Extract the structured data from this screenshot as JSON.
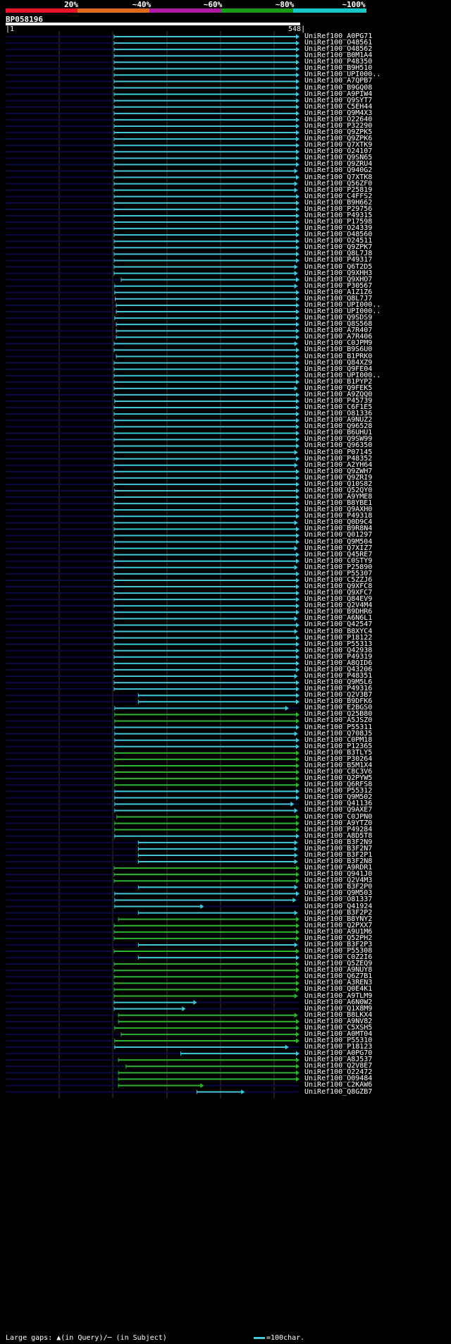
{
  "legend": {
    "ticks": [
      "20%",
      "~40%",
      "~60%",
      "~80%",
      "~100%"
    ],
    "colors": [
      "#e8142a",
      "#e06a1a",
      "#b01aa0",
      "#1a9a1a",
      "#18c8c8"
    ]
  },
  "query": {
    "name": "BP058196",
    "start": "1",
    "end": "548"
  },
  "colors": {
    "hit_cyan": "#41c6d6",
    "hit_green": "#2db52d",
    "track": "#0a0a44",
    "grid": "#3a3a3a"
  },
  "hits": [
    {
      "label": "UniRef100_A0PG71",
      "color": "cyan",
      "start": 203,
      "end": 548
    },
    {
      "label": "UniRef100_O48561",
      "color": "cyan",
      "start": 203,
      "end": 548
    },
    {
      "label": "UniRef100_O48562",
      "color": "cyan",
      "start": 203,
      "end": 548
    },
    {
      "label": "UniRef100_B0M1A4",
      "color": "cyan",
      "start": 203,
      "end": 548
    },
    {
      "label": "UniRef100_P48350",
      "color": "cyan",
      "start": 203,
      "end": 548
    },
    {
      "label": "UniRef100_B9H510",
      "color": "cyan",
      "start": 203,
      "end": 548
    },
    {
      "label": "UniRef100_UPI000..",
      "color": "cyan",
      "start": 203,
      "end": 548
    },
    {
      "label": "UniRef100_A7QPB7",
      "color": "cyan",
      "start": 203,
      "end": 548
    },
    {
      "label": "UniRef100_B9GQ08",
      "color": "cyan",
      "start": 203,
      "end": 548
    },
    {
      "label": "UniRef100_A9PIW4",
      "color": "cyan",
      "start": 203,
      "end": 548
    },
    {
      "label": "UniRef100_Q9SYT7",
      "color": "cyan",
      "start": 203,
      "end": 548
    },
    {
      "label": "UniRef100_C5EH44",
      "color": "cyan",
      "start": 203,
      "end": 548
    },
    {
      "label": "UniRef100_Q9M4X3",
      "color": "cyan",
      "start": 203,
      "end": 548
    },
    {
      "label": "UniRef100_O22640",
      "color": "cyan",
      "start": 203,
      "end": 548
    },
    {
      "label": "UniRef100_P32290",
      "color": "cyan",
      "start": 203,
      "end": 548
    },
    {
      "label": "UniRef100_Q9ZPK5",
      "color": "cyan",
      "start": 203,
      "end": 548
    },
    {
      "label": "UniRef100_Q9ZPK6",
      "color": "cyan",
      "start": 203,
      "end": 548
    },
    {
      "label": "UniRef100_Q7XTK9",
      "color": "cyan",
      "start": 203,
      "end": 548
    },
    {
      "label": "UniRef100_O24107",
      "color": "cyan",
      "start": 203,
      "end": 548
    },
    {
      "label": "UniRef100_Q9SN65",
      "color": "cyan",
      "start": 203,
      "end": 548
    },
    {
      "label": "UniRef100_Q9ZRU4",
      "color": "cyan",
      "start": 203,
      "end": 548
    },
    {
      "label": "UniRef100_Q940G2",
      "color": "cyan",
      "start": 203,
      "end": 545
    },
    {
      "label": "UniRef100_Q7XTK8",
      "color": "cyan",
      "start": 203,
      "end": 548
    },
    {
      "label": "UniRef100_Q56ZF0",
      "color": "cyan",
      "start": 203,
      "end": 545
    },
    {
      "label": "UniRef100_P25819",
      "color": "cyan",
      "start": 203,
      "end": 545
    },
    {
      "label": "UniRef100_C4FFS2",
      "color": "cyan",
      "start": 203,
      "end": 548
    },
    {
      "label": "UniRef100_B9H662",
      "color": "cyan",
      "start": 203,
      "end": 548
    },
    {
      "label": "UniRef100_P29756",
      "color": "cyan",
      "start": 203,
      "end": 548
    },
    {
      "label": "UniRef100_P49315",
      "color": "cyan",
      "start": 203,
      "end": 548
    },
    {
      "label": "UniRef100_P17598",
      "color": "cyan",
      "start": 203,
      "end": 548
    },
    {
      "label": "UniRef100_O24339",
      "color": "cyan",
      "start": 203,
      "end": 548
    },
    {
      "label": "UniRef100_O48560",
      "color": "cyan",
      "start": 203,
      "end": 548
    },
    {
      "label": "UniRef100_O24511",
      "color": "cyan",
      "start": 203,
      "end": 548
    },
    {
      "label": "UniRef100_Q9ZPK7",
      "color": "cyan",
      "start": 203,
      "end": 548
    },
    {
      "label": "UniRef100_Q8L7J8",
      "color": "cyan",
      "start": 203,
      "end": 548
    },
    {
      "label": "UniRef100_P49317",
      "color": "cyan",
      "start": 203,
      "end": 548
    },
    {
      "label": "UniRef100_Q6T2D5",
      "color": "cyan",
      "start": 203,
      "end": 545
    },
    {
      "label": "UniRef100_Q9XHH3",
      "color": "cyan",
      "start": 203,
      "end": 545
    },
    {
      "label": "UniRef100_Q9XHO7",
      "color": "cyan",
      "start": 216,
      "end": 548
    },
    {
      "label": "UniRef100_P30567",
      "color": "cyan",
      "start": 204,
      "end": 545
    },
    {
      "label": "UniRef100_A1Z1Z6",
      "color": "cyan",
      "start": 204,
      "end": 548
    },
    {
      "label": "UniRef100_Q8L7J7",
      "color": "cyan",
      "start": 205,
      "end": 548
    },
    {
      "label": "UniRef100_UPI000..",
      "color": "cyan",
      "start": 207,
      "end": 548
    },
    {
      "label": "UniRef100_UPI000..",
      "color": "cyan",
      "start": 207,
      "end": 548
    },
    {
      "label": "UniRef100_Q9SDS9",
      "color": "cyan",
      "start": 204,
      "end": 548
    },
    {
      "label": "UniRef100_Q8S568",
      "color": "cyan",
      "start": 207,
      "end": 548
    },
    {
      "label": "UniRef100_A7R407",
      "color": "cyan",
      "start": 207,
      "end": 548
    },
    {
      "label": "UniRef100_A7R406",
      "color": "cyan",
      "start": 207,
      "end": 548
    },
    {
      "label": "UniRef100_C0JPM9",
      "color": "cyan",
      "start": 203,
      "end": 545
    },
    {
      "label": "UniRef100_B9S6U0",
      "color": "cyan",
      "start": 203,
      "end": 548
    },
    {
      "label": "UniRef100_B1PRK0",
      "color": "cyan",
      "start": 207,
      "end": 548
    },
    {
      "label": "UniRef100_Q84XZ9",
      "color": "cyan",
      "start": 203,
      "end": 548
    },
    {
      "label": "UniRef100_Q9FE04",
      "color": "cyan",
      "start": 203,
      "end": 548
    },
    {
      "label": "UniRef100_UPI000..",
      "color": "cyan",
      "start": 203,
      "end": 548
    },
    {
      "label": "UniRef100_B1PYP2",
      "color": "cyan",
      "start": 203,
      "end": 548
    },
    {
      "label": "UniRef100_Q9FEK5",
      "color": "cyan",
      "start": 203,
      "end": 545
    },
    {
      "label": "UniRef100_A9ZQQ0",
      "color": "cyan",
      "start": 203,
      "end": 548
    },
    {
      "label": "UniRef100_P45739",
      "color": "cyan",
      "start": 204,
      "end": 548
    },
    {
      "label": "UniRef100_C6F1E5",
      "color": "cyan",
      "start": 203,
      "end": 548
    },
    {
      "label": "UniRef100_O81336",
      "color": "cyan",
      "start": 203,
      "end": 548
    },
    {
      "label": "UniRef100_A9NUZ2",
      "color": "cyan",
      "start": 203,
      "end": 548
    },
    {
      "label": "UniRef100_Q96528",
      "color": "cyan",
      "start": 204,
      "end": 548
    },
    {
      "label": "UniRef100_B6UHU1",
      "color": "cyan",
      "start": 203,
      "end": 548
    },
    {
      "label": "UniRef100_Q9SW99",
      "color": "cyan",
      "start": 203,
      "end": 548
    },
    {
      "label": "UniRef100_Q96350",
      "color": "cyan",
      "start": 203,
      "end": 548
    },
    {
      "label": "UniRef100_P07145",
      "color": "cyan",
      "start": 203,
      "end": 545
    },
    {
      "label": "UniRef100_P48352",
      "color": "cyan",
      "start": 203,
      "end": 548
    },
    {
      "label": "UniRef100_A2YH64",
      "color": "cyan",
      "start": 203,
      "end": 545
    },
    {
      "label": "UniRef100_Q9ZWH7",
      "color": "cyan",
      "start": 203,
      "end": 548
    },
    {
      "label": "UniRef100_Q9ZRI9",
      "color": "cyan",
      "start": 203,
      "end": 548
    },
    {
      "label": "UniRef100_Q10S82",
      "color": "cyan",
      "start": 203,
      "end": 548
    },
    {
      "label": "UniRef100_Q52QY0",
      "color": "cyan",
      "start": 204,
      "end": 548
    },
    {
      "label": "UniRef100_A9YME8",
      "color": "cyan",
      "start": 204,
      "end": 548
    },
    {
      "label": "UniRef100_B8YBE1",
      "color": "cyan",
      "start": 203,
      "end": 548
    },
    {
      "label": "UniRef100_Q9AXH0",
      "color": "cyan",
      "start": 203,
      "end": 548
    },
    {
      "label": "UniRef100_P49318",
      "color": "cyan",
      "start": 203,
      "end": 548
    },
    {
      "label": "UniRef100_Q0D9C4",
      "color": "cyan",
      "start": 203,
      "end": 545
    },
    {
      "label": "UniRef100_B9R8N4",
      "color": "cyan",
      "start": 203,
      "end": 548
    },
    {
      "label": "UniRef100_Q01297",
      "color": "cyan",
      "start": 203,
      "end": 548
    },
    {
      "label": "UniRef100_Q9M504",
      "color": "cyan",
      "start": 204,
      "end": 548
    },
    {
      "label": "UniRef100_Q7XIZ7",
      "color": "cyan",
      "start": 203,
      "end": 545
    },
    {
      "label": "UniRef100_Q45RE7",
      "color": "cyan",
      "start": 203,
      "end": 548
    },
    {
      "label": "UniRef100_C0STY9",
      "color": "cyan",
      "start": 203,
      "end": 548
    },
    {
      "label": "UniRef100_P25890",
      "color": "cyan",
      "start": 203,
      "end": 545
    },
    {
      "label": "UniRef100_P55307",
      "color": "cyan",
      "start": 203,
      "end": 548
    },
    {
      "label": "UniRef100_C5ZZJ6",
      "color": "cyan",
      "start": 203,
      "end": 548
    },
    {
      "label": "UniRef100_Q9XFC8",
      "color": "cyan",
      "start": 203,
      "end": 548
    },
    {
      "label": "UniRef100_Q9XFC7",
      "color": "cyan",
      "start": 203,
      "end": 548
    },
    {
      "label": "UniRef100_Q84EV9",
      "color": "cyan",
      "start": 203,
      "end": 548
    },
    {
      "label": "UniRef100_Q2V4M4",
      "color": "cyan",
      "start": 203,
      "end": 548
    },
    {
      "label": "UniRef100_B9DHR6",
      "color": "cyan",
      "start": 203,
      "end": 548
    },
    {
      "label": "UniRef100_A6N6L1",
      "color": "cyan",
      "start": 203,
      "end": 545
    },
    {
      "label": "UniRef100_Q42547",
      "color": "cyan",
      "start": 203,
      "end": 548
    },
    {
      "label": "UniRef100_B8XYC4",
      "color": "cyan",
      "start": 203,
      "end": 545
    },
    {
      "label": "UniRef100_P18122",
      "color": "cyan",
      "start": 203,
      "end": 548
    },
    {
      "label": "UniRef100_P55313",
      "color": "cyan",
      "start": 203,
      "end": 548
    },
    {
      "label": "UniRef100_Q42938",
      "color": "cyan",
      "start": 203,
      "end": 548
    },
    {
      "label": "UniRef100_P49319",
      "color": "cyan",
      "start": 203,
      "end": 548
    },
    {
      "label": "UniRef100_A8QID6",
      "color": "cyan",
      "start": 203,
      "end": 548
    },
    {
      "label": "UniRef100_Q43206",
      "color": "cyan",
      "start": 203,
      "end": 548
    },
    {
      "label": "UniRef100_P48351",
      "color": "cyan",
      "start": 203,
      "end": 545
    },
    {
      "label": "UniRef100_Q9M5L6",
      "color": "cyan",
      "start": 203,
      "end": 548
    },
    {
      "label": "UniRef100_P49316",
      "color": "cyan",
      "start": 203,
      "end": 548
    },
    {
      "label": "UniRef100_Q2V3B7",
      "color": "cyan",
      "start": 248,
      "end": 548
    },
    {
      "label": "UniRef100_B9DFK6",
      "color": "cyan",
      "start": 248,
      "end": 548
    },
    {
      "label": "UniRef100_E2BGS0",
      "color": "cyan",
      "start": 204,
      "end": 528
    },
    {
      "label": "UniRef100_Q25B80",
      "color": "green",
      "start": 204,
      "end": 548
    },
    {
      "label": "UniRef100_A5JSZ0",
      "color": "green",
      "start": 204,
      "end": 548
    },
    {
      "label": "UniRef100_P55311",
      "color": "cyan",
      "start": 204,
      "end": 548
    },
    {
      "label": "UniRef100_Q708J5",
      "color": "cyan",
      "start": 204,
      "end": 545
    },
    {
      "label": "UniRef100_C0PM18",
      "color": "cyan",
      "start": 204,
      "end": 548
    },
    {
      "label": "UniRef100_P12365",
      "color": "cyan",
      "start": 204,
      "end": 548
    },
    {
      "label": "UniRef100_B3TLY5",
      "color": "green",
      "start": 204,
      "end": 548
    },
    {
      "label": "UniRef100_P30264",
      "color": "green",
      "start": 204,
      "end": 548
    },
    {
      "label": "UniRef100_B5M1X4",
      "color": "green",
      "start": 204,
      "end": 548
    },
    {
      "label": "UniRef100_C8C3V6",
      "color": "green",
      "start": 204,
      "end": 548
    },
    {
      "label": "UniRef100_Q2PYW5",
      "color": "green",
      "start": 204,
      "end": 548
    },
    {
      "label": "UniRef100_Q6RFS8",
      "color": "green",
      "start": 204,
      "end": 548
    },
    {
      "label": "UniRef100_P55312",
      "color": "cyan",
      "start": 204,
      "end": 548
    },
    {
      "label": "UniRef100_Q9M502",
      "color": "cyan",
      "start": 204,
      "end": 548
    },
    {
      "label": "UniRef100_Q41136",
      "color": "cyan",
      "start": 204,
      "end": 538
    },
    {
      "label": "UniRef100_Q9AXE7",
      "color": "cyan",
      "start": 204,
      "end": 545
    },
    {
      "label": "UniRef100_C0JPN0",
      "color": "green",
      "start": 208,
      "end": 548
    },
    {
      "label": "UniRef100_A9YTZ0",
      "color": "green",
      "start": 204,
      "end": 548
    },
    {
      "label": "UniRef100_P49284",
      "color": "green",
      "start": 204,
      "end": 548
    },
    {
      "label": "UniRef100_A8D5T8",
      "color": "cyan",
      "start": 204,
      "end": 548
    },
    {
      "label": "UniRef100_B3F2N9",
      "color": "cyan",
      "start": 248,
      "end": 545
    },
    {
      "label": "UniRef100_B3F2N7",
      "color": "cyan",
      "start": 248,
      "end": 545
    },
    {
      "label": "UniRef100_B3F2P1",
      "color": "cyan",
      "start": 248,
      "end": 545
    },
    {
      "label": "UniRef100_B3F2N8",
      "color": "cyan",
      "start": 248,
      "end": 545
    },
    {
      "label": "UniRef100_A9RDR1",
      "color": "green",
      "start": 203,
      "end": 548
    },
    {
      "label": "UniRef100_Q941J0",
      "color": "green",
      "start": 203,
      "end": 548
    },
    {
      "label": "UniRef100_Q2V4M3",
      "color": "green",
      "start": 203,
      "end": 548
    },
    {
      "label": "UniRef100_B3F2P0",
      "color": "cyan",
      "start": 248,
      "end": 545
    },
    {
      "label": "UniRef100_Q9M503",
      "color": "cyan",
      "start": 204,
      "end": 548
    },
    {
      "label": "UniRef100_O81337",
      "color": "cyan",
      "start": 204,
      "end": 542
    },
    {
      "label": "UniRef100_Q41924",
      "color": "cyan",
      "start": 204,
      "end": 370
    },
    {
      "label": "UniRef100_B3F2P2",
      "color": "cyan",
      "start": 248,
      "end": 545
    },
    {
      "label": "UniRef100_B8YNY2",
      "color": "green",
      "start": 211,
      "end": 548
    },
    {
      "label": "UniRef100_Q2PXX7",
      "color": "green",
      "start": 203,
      "end": 548
    },
    {
      "label": "UniRef100_A9U1M6",
      "color": "green",
      "start": 203,
      "end": 548
    },
    {
      "label": "UniRef100_Q52PH2",
      "color": "green",
      "start": 203,
      "end": 548
    },
    {
      "label": "UniRef100_B3F2P3",
      "color": "cyan",
      "start": 248,
      "end": 545
    },
    {
      "label": "UniRef100_P55308",
      "color": "green",
      "start": 203,
      "end": 548
    },
    {
      "label": "UniRef100_C0Z2I6",
      "color": "cyan",
      "start": 248,
      "end": 548
    },
    {
      "label": "UniRef100_Q5ZEQ9",
      "color": "green",
      "start": 203,
      "end": 548
    },
    {
      "label": "UniRef100_A9NUY8",
      "color": "green",
      "start": 203,
      "end": 548
    },
    {
      "label": "UniRef100_Q6Z7B1",
      "color": "green",
      "start": 203,
      "end": 548
    },
    {
      "label": "UniRef100_A3REN3",
      "color": "green",
      "start": 203,
      "end": 548
    },
    {
      "label": "UniRef100_Q0E4K1",
      "color": "green",
      "start": 203,
      "end": 548
    },
    {
      "label": "UniRef100_A9TLM9",
      "color": "green",
      "start": 203,
      "end": 545
    },
    {
      "label": "UniRef100_A6N0W2",
      "color": "cyan",
      "start": 203,
      "end": 357
    },
    {
      "label": "UniRef100_Q1X8M9",
      "color": "cyan",
      "start": 203,
      "end": 336
    },
    {
      "label": "UniRef100_B8LKX4",
      "color": "green",
      "start": 211,
      "end": 545
    },
    {
      "label": "UniRef100_A9NV82",
      "color": "green",
      "start": 211,
      "end": 548
    },
    {
      "label": "UniRef100_C5XSH5",
      "color": "green",
      "start": 204,
      "end": 548
    },
    {
      "label": "UniRef100_A0MT04",
      "color": "green",
      "start": 216,
      "end": 548
    },
    {
      "label": "UniRef100_P55310",
      "color": "green",
      "start": 204,
      "end": 548
    },
    {
      "label": "UniRef100_P18123",
      "color": "cyan",
      "start": 204,
      "end": 528
    },
    {
      "label": "UniRef100_A0PG70",
      "color": "cyan",
      "start": 327,
      "end": 548
    },
    {
      "label": "UniRef100_A8J537",
      "color": "green",
      "start": 211,
      "end": 548
    },
    {
      "label": "UniRef100_Q2V8E7",
      "color": "green",
      "start": 225,
      "end": 548
    },
    {
      "label": "UniRef100_O22472",
      "color": "green",
      "start": 211,
      "end": 548
    },
    {
      "label": "UniRef100_O09484",
      "color": "green",
      "start": 211,
      "end": 548
    },
    {
      "label": "UniRef100_C2KAW6",
      "color": "green",
      "start": 211,
      "end": 370
    },
    {
      "label": "UniRef100_Q8GZB7",
      "color": "cyan",
      "start": 357,
      "end": 446
    }
  ],
  "footer": {
    "left": "Large gaps: ▲(in Query)/─ (in Subject)",
    "right": "=100char."
  }
}
